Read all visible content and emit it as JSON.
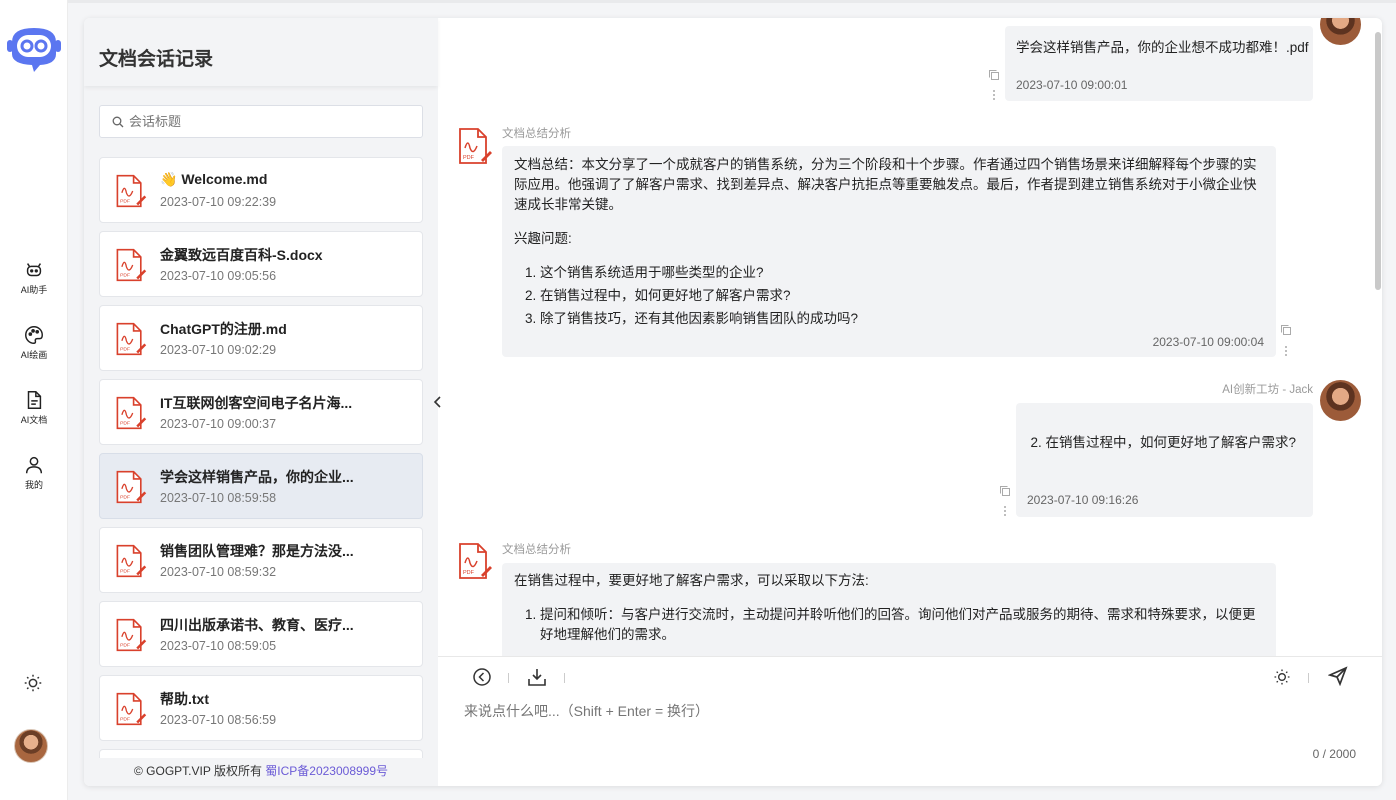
{
  "nav": {
    "items": [
      {
        "label": "AI助手",
        "icon": "robot-icon"
      },
      {
        "label": "AI绘画",
        "icon": "palette-icon"
      },
      {
        "label": "AI文档",
        "icon": "document-icon"
      },
      {
        "label": "我的",
        "icon": "user-icon"
      }
    ]
  },
  "doc_list": {
    "title": "文档会话记录",
    "search_placeholder": "会话标题",
    "items": [
      {
        "title": "👋 Welcome.md",
        "time": "2023-07-10 09:22:39"
      },
      {
        "title": "金翼致远百度百科-S.docx",
        "time": "2023-07-10 09:05:56"
      },
      {
        "title": "ChatGPT的注册.md",
        "time": "2023-07-10 09:02:29"
      },
      {
        "title": "IT互联网创客空间电子名片海...",
        "time": "2023-07-10 09:00:37"
      },
      {
        "title": "学会这样销售产品，你的企业...",
        "time": "2023-07-10 08:59:58"
      },
      {
        "title": "销售团队管理难？那是方法没...",
        "time": "2023-07-10 08:59:32"
      },
      {
        "title": "四川出版承诺书、教育、医疗...",
        "time": "2023-07-10 08:59:05"
      },
      {
        "title": "帮助.txt",
        "time": "2023-07-10 08:56:59"
      }
    ],
    "active_index": 4,
    "footer_text": "© GOGPT.VIP 版权所有 ",
    "footer_link": "蜀ICP备2023008999号"
  },
  "chat": {
    "user_msg_1": {
      "text": "学会这样销售产品，你的企业想不成功都难！.pdf",
      "time": "2023-07-10 09:00:01"
    },
    "ai_msg_1": {
      "sender": "文档总结分析",
      "summary": "文档总结：本文分享了一个成就客户的销售系统，分为三个阶段和十个步骤。作者通过四个销售场景来详细解释每个步骤的实际应用。他强调了了解客户需求、找到差异点、解决客户抗拒点等重要触发点。最后，作者提到建立销售系统对于小微企业快速成长非常关键。",
      "interest_label": "兴趣问题:",
      "questions": [
        "这个销售系统适用于哪些类型的企业?",
        "在销售过程中，如何更好地了解客户需求?",
        "除了销售技巧，还有其他因素影响销售团队的成功吗?"
      ],
      "time": "2023-07-10 09:00:04"
    },
    "user_msg_2": {
      "sender": "AI创新工坊 - Jack",
      "text": "2. 在销售过程中，如何更好地了解客户需求?",
      "time": "2023-07-10 09:16:26"
    },
    "ai_msg_2": {
      "sender": "文档总结分析",
      "intro": "在销售过程中，要更好地了解客户需求，可以采取以下方法:",
      "points": [
        "提问和倾听：与客户进行交流时，主动提问并聆听他们的回答。询问他们对产品或服务的期待、需求和特殊要求，以便更好地理解他们的需求。"
      ]
    }
  },
  "input": {
    "placeholder": "来说点什么吧...（Shift + Enter = 换行）",
    "counter": "0 / 2000"
  },
  "colors": {
    "accent": "#6b5bd6",
    "pdf_red": "#d9412c",
    "logo_blue": "#5b76f0"
  }
}
